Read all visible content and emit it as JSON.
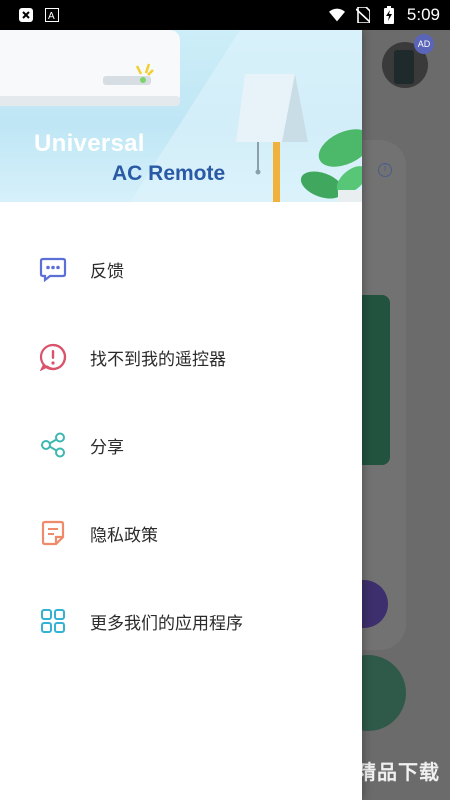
{
  "status_bar": {
    "time": "5:09",
    "left_icons": [
      "close-circle-icon",
      "font-a-icon"
    ],
    "right_icons": [
      "wifi-icon",
      "no-sim-icon",
      "battery-charging-icon"
    ]
  },
  "drawer": {
    "header": {
      "title_line1": "Universal",
      "title_line2": "AC Remote"
    },
    "menu_items": [
      {
        "label": "反馈",
        "icon": "chat-bubble-icon",
        "color": "#5b6fd6"
      },
      {
        "label": "找不到我的遥控器",
        "icon": "alert-circle-icon",
        "color": "#d9536b"
      },
      {
        "label": "分享",
        "icon": "share-icon",
        "color": "#3fb7b0"
      },
      {
        "label": "隐私政策",
        "icon": "document-icon",
        "color": "#ef8a6a"
      },
      {
        "label": "更多我们的应用程序",
        "icon": "grid-apps-icon",
        "color": "#34b2d2"
      }
    ]
  },
  "background": {
    "ad_badge": "AD",
    "watermark_text": "精品下载"
  },
  "colors": {
    "overlay": "#6b6b6b",
    "header_sky": "#bfe6f5",
    "title_blue": "#2a5aa6"
  }
}
